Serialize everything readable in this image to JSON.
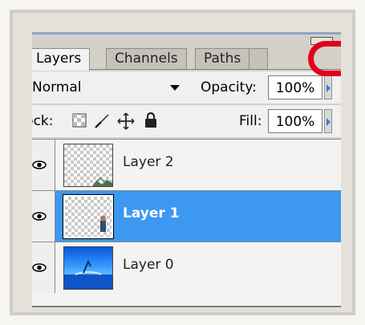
{
  "tabs": {
    "layers": "Layers",
    "channels": "Channels",
    "paths": "Paths"
  },
  "blend": {
    "mode": "Normal"
  },
  "opacity": {
    "label": "Opacity:",
    "value": "100%"
  },
  "lock": {
    "label": "Lock:"
  },
  "fill": {
    "label": "Fill:",
    "value": "100%"
  },
  "layers": [
    {
      "name": "Layer 2",
      "selected": false
    },
    {
      "name": "Layer 1",
      "selected": true
    },
    {
      "name": "Layer 0",
      "selected": false
    }
  ],
  "colors": {
    "selection": "#3d98f2",
    "annotation": "#e2001a",
    "tab_bar": "#d4d0c8"
  },
  "icons": [
    "eye-icon",
    "lock-transparent-icon",
    "brush-icon",
    "move-icon",
    "lock-icon"
  ]
}
